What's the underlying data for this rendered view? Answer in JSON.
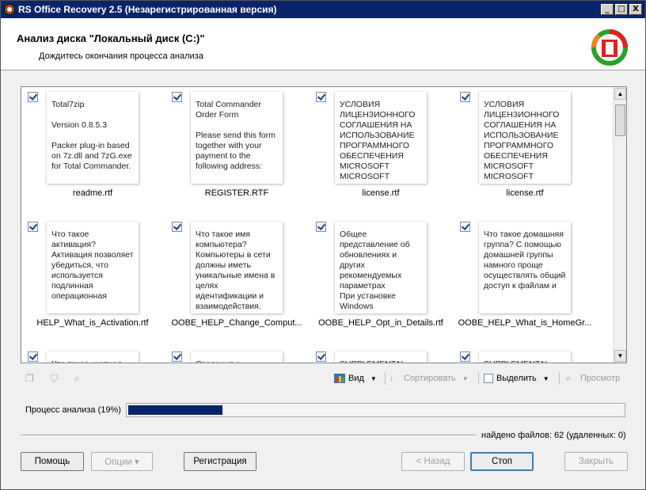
{
  "window": {
    "title": "RS Office Recovery 2.5 (Незарегистрированная версия)",
    "controls": [
      "_",
      "□",
      "X"
    ]
  },
  "header": {
    "title": "Анализ диска \"Локальный диск (C:)\"",
    "subtitle": "Дождитесь окончания процесса анализа"
  },
  "files": [
    {
      "name": "readme.rtf",
      "preview": "Total7zip\n\nVersion 0.8.5.3\n\nPacker plug-in based on 7z.dll and 7zG.exe for Total Commander.",
      "checked": true
    },
    {
      "name": "REGISTER.RTF",
      "preview": "Total Commander Order Form\n\nPlease send this form together with your payment to the following address:",
      "checked": true
    },
    {
      "name": "license.rtf",
      "preview": "УСЛОВИЯ ЛИЦЕНЗИОННОГО СОГЛАШЕНИЯ НА ИСПОЛЬЗОВАНИЕ ПРОГРАММНОГО ОБЕСПЕЧЕНИЯ MICROSOFT MICROSOFT",
      "checked": true
    },
    {
      "name": "license.rtf",
      "preview": "УСЛОВИЯ ЛИЦЕНЗИОННОГО СОГЛАШЕНИЯ НА ИСПОЛЬЗОВАНИЕ ПРОГРАММНОГО ОБЕСПЕЧЕНИЯ MICROSOFT MICROSOFT",
      "checked": true
    },
    {
      "name": "HELP_What_is_Activation.rtf",
      "preview": "Что такое активация? Активация позволяет убедиться, что используется подлинная операционная",
      "checked": true
    },
    {
      "name": "OOBE_HELP_Change_Comput...",
      "preview": "Что такое имя компьютера? Компьютеры в сети должны иметь уникальные имена в целях идентификации и взаимодействия.",
      "checked": true
    },
    {
      "name": "OOBE_HELP_Opt_in_Details.rtf",
      "preview": "Общее представление об обновлениях и других рекомендуемых параметрах\nПри установке Windows",
      "checked": true
    },
    {
      "name": "OOBE_HELP_What_is_HomeGr...",
      "preview": "Что такое домашняя группа? С помощью домашней группы намного проще осуществлять общий доступ к файлам и",
      "checked": true
    },
    {
      "name": "",
      "preview": "Что такое учетная",
      "checked": true
    },
    {
      "name": "",
      "preview": "Сведения о",
      "checked": true
    },
    {
      "name": "",
      "preview": "SUPPLEMENTAL",
      "checked": true
    },
    {
      "name": "",
      "preview": "SUPPLEMENTAL",
      "checked": true
    }
  ],
  "toolbar": {
    "view_label": "Вид",
    "sort_label": "Сортировать",
    "select_label": "Выделить",
    "preview_label": "Просмотр"
  },
  "progress": {
    "label": "Процесс анализа (19%)",
    "value": 0.19
  },
  "status": {
    "found": "найдено файлов: 62 (удаленных: 0)"
  },
  "buttons": {
    "help": "Помощь",
    "options": "Опции ▾",
    "register": "Регистрация",
    "back": "< Назад",
    "stop": "Стоп",
    "close": "Закрыть"
  },
  "colors": {
    "titlebar": "#0a246a",
    "progress_fill": "#0a246a"
  }
}
